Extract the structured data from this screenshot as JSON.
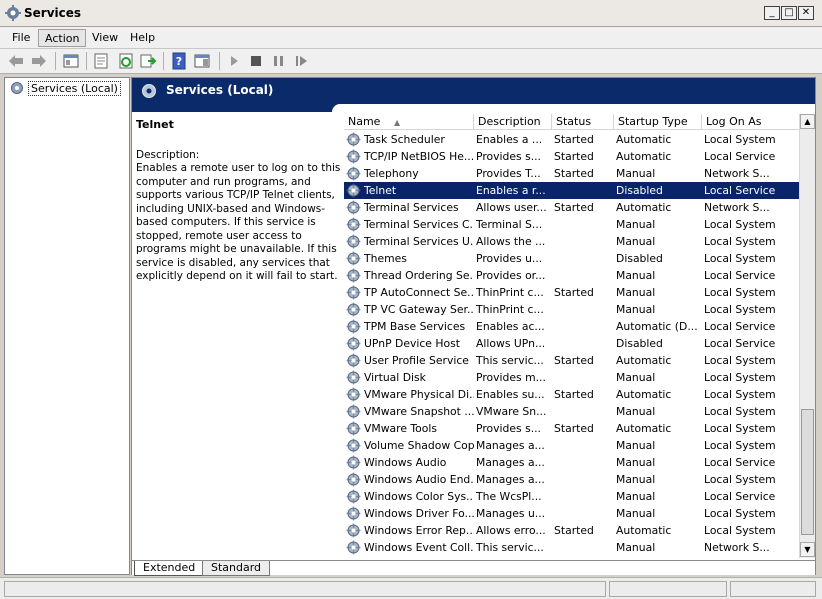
{
  "window": {
    "title": "Services"
  },
  "menu": [
    "File",
    "Action",
    "View",
    "Help"
  ],
  "tree": {
    "root_label": "Services (Local)"
  },
  "header": {
    "title": "Services (Local)"
  },
  "description": {
    "service_name": "Telnet",
    "label": "Description:",
    "text": "Enables a remote user to log on to this computer and run programs, and supports various TCP/IP Telnet clients, including UNIX-based and Windows-based computers. If this service is stopped, remote user access to programs might be unavailable. If this service is disabled, any services that explicitly depend on it will fail to start."
  },
  "columns": [
    "Name",
    "Description",
    "Status",
    "Startup Type",
    "Log On As"
  ],
  "sorted_column": "Name",
  "selected_row": "Telnet",
  "rows": [
    {
      "name": "Task Scheduler",
      "description": "Enables a ...",
      "status": "Started",
      "startup": "Automatic",
      "logon": "Local System"
    },
    {
      "name": "TCP/IP NetBIOS He...",
      "description": "Provides s...",
      "status": "Started",
      "startup": "Automatic",
      "logon": "Local Service"
    },
    {
      "name": "Telephony",
      "description": "Provides T...",
      "status": "Started",
      "startup": "Manual",
      "logon": "Network S..."
    },
    {
      "name": "Telnet",
      "description": "Enables a r...",
      "status": "",
      "startup": "Disabled",
      "logon": "Local Service"
    },
    {
      "name": "Terminal Services",
      "description": "Allows user...",
      "status": "Started",
      "startup": "Automatic",
      "logon": "Network S..."
    },
    {
      "name": "Terminal Services C...",
      "description": "Terminal S...",
      "status": "",
      "startup": "Manual",
      "logon": "Local System"
    },
    {
      "name": "Terminal Services U...",
      "description": "Allows the ...",
      "status": "",
      "startup": "Manual",
      "logon": "Local System"
    },
    {
      "name": "Themes",
      "description": "Provides u...",
      "status": "",
      "startup": "Disabled",
      "logon": "Local System"
    },
    {
      "name": "Thread Ordering Se...",
      "description": "Provides or...",
      "status": "",
      "startup": "Manual",
      "logon": "Local Service"
    },
    {
      "name": "TP AutoConnect Se...",
      "description": "ThinPrint c...",
      "status": "Started",
      "startup": "Manual",
      "logon": "Local System"
    },
    {
      "name": "TP VC Gateway Ser...",
      "description": "ThinPrint c...",
      "status": "",
      "startup": "Manual",
      "logon": "Local System"
    },
    {
      "name": "TPM Base Services",
      "description": "Enables ac...",
      "status": "",
      "startup": "Automatic (D...",
      "logon": "Local Service"
    },
    {
      "name": "UPnP Device Host",
      "description": "Allows UPn...",
      "status": "",
      "startup": "Disabled",
      "logon": "Local Service"
    },
    {
      "name": "User Profile Service",
      "description": "This servic...",
      "status": "Started",
      "startup": "Automatic",
      "logon": "Local System"
    },
    {
      "name": "Virtual Disk",
      "description": "Provides m...",
      "status": "",
      "startup": "Manual",
      "logon": "Local System"
    },
    {
      "name": "VMware Physical Di...",
      "description": "Enables su...",
      "status": "Started",
      "startup": "Automatic",
      "logon": "Local System"
    },
    {
      "name": "VMware Snapshot ...",
      "description": "VMware Sn...",
      "status": "",
      "startup": "Manual",
      "logon": "Local System"
    },
    {
      "name": "VMware Tools",
      "description": "Provides s...",
      "status": "Started",
      "startup": "Automatic",
      "logon": "Local System"
    },
    {
      "name": "Volume Shadow Copy",
      "description": "Manages a...",
      "status": "",
      "startup": "Manual",
      "logon": "Local System"
    },
    {
      "name": "Windows Audio",
      "description": "Manages a...",
      "status": "",
      "startup": "Manual",
      "logon": "Local Service"
    },
    {
      "name": "Windows Audio End...",
      "description": "Manages a...",
      "status": "",
      "startup": "Manual",
      "logon": "Local System"
    },
    {
      "name": "Windows Color Sys...",
      "description": "The WcsPl...",
      "status": "",
      "startup": "Manual",
      "logon": "Local Service"
    },
    {
      "name": "Windows Driver Fo...",
      "description": "Manages u...",
      "status": "",
      "startup": "Manual",
      "logon": "Local System"
    },
    {
      "name": "Windows Error Rep...",
      "description": "Allows erro...",
      "status": "Started",
      "startup": "Automatic",
      "logon": "Local System"
    },
    {
      "name": "Windows Event Coll...",
      "description": "This servic...",
      "status": "",
      "startup": "Manual",
      "logon": "Network S..."
    }
  ],
  "tabs": [
    "Extended",
    "Standard"
  ],
  "active_tab": "Extended",
  "colors": {
    "header_bg": "#0b2a6a",
    "selection_bg": "#0a246a"
  },
  "icons": {
    "toolbar": [
      "back-arrow-icon",
      "forward-arrow-icon",
      "console-tree-icon",
      "properties-icon",
      "refresh-icon",
      "export-list-icon",
      "help-icon",
      "show-hide-pane-icon",
      "start-service-icon",
      "stop-service-icon",
      "pause-service-icon",
      "restart-service-icon"
    ],
    "service": "gear-icon"
  }
}
